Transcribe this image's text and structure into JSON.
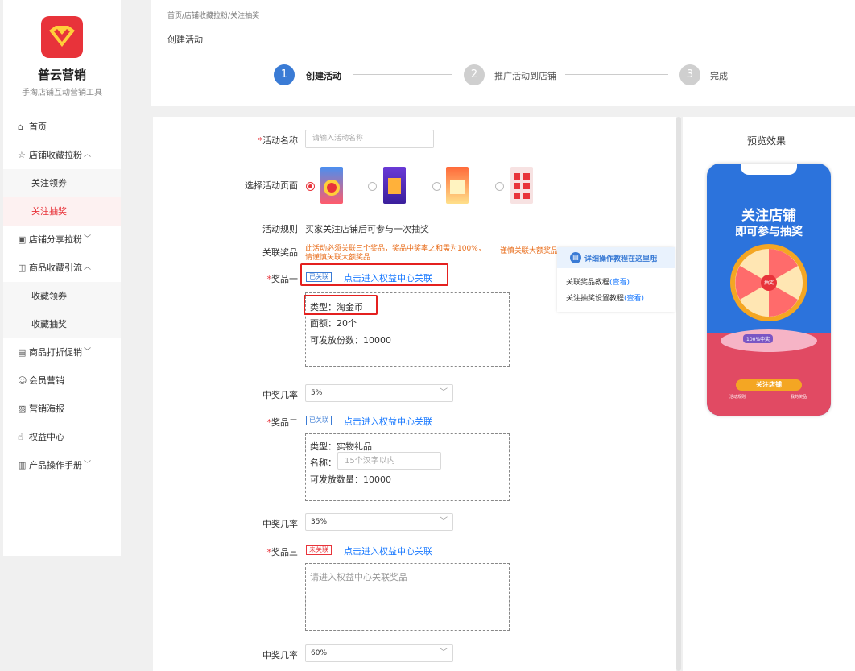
{
  "sidebar": {
    "brand": "普云营销",
    "brand_sub": "手淘店铺互动营销工具",
    "home": "首页",
    "group1": "店铺收藏拉粉",
    "group1_items": [
      "关注领券",
      "关注抽奖"
    ],
    "group2": "店铺分享拉粉",
    "group3": "商品收藏引流",
    "group3_items": [
      "收藏领券",
      "收藏抽奖"
    ],
    "group4": "商品打折促销",
    "members": "会员营销",
    "poster": "营销海报",
    "rights": "权益中心",
    "manual": "产品操作手册"
  },
  "header": {
    "breadcrumb": "首页/店铺收藏拉粉/关注抽奖",
    "title": "创建活动",
    "steps": [
      {
        "num": "1",
        "label": "创建活动"
      },
      {
        "num": "2",
        "label": "推广活动到店铺"
      },
      {
        "num": "3",
        "label": "完成"
      }
    ]
  },
  "form": {
    "name_label": "活动名称",
    "name_placeholder": "请输入活动名称",
    "page_label": "选择活动页面",
    "rule_label": "活动规则",
    "rule_value": "买家关注店铺后可参与一次抽奖",
    "prize_label": "关联奖品",
    "prize_warn_1": "此活动必须关联三个奖品，奖品中奖率之和需为100%，",
    "prize_warn_2": "请谨慎关联大额奖品",
    "prize_warn_3": "谨慎关联大额奖品",
    "prize1": {
      "label": "奖品一",
      "tag": "已关联",
      "link": "点击进入权益中心关联",
      "type": "类型：淘金币",
      "amount": "面额：20个",
      "count": "可发放份数：10000",
      "rate_label": "中奖几率",
      "rate": "5%"
    },
    "prize2": {
      "label": "奖品二",
      "tag": "已关联",
      "link": "点击进入权益中心关联",
      "type": "类型：实物礼品",
      "name_label": "名称：",
      "name_placeholder": "15个汉字以内",
      "count": "可发放数量：10000",
      "rate_label": "中奖几率",
      "rate": "35%"
    },
    "prize3": {
      "label": "奖品三",
      "tag": "未关联",
      "link": "点击进入权益中心关联",
      "placeholder": "请进入权益中心关联奖品",
      "rate_label": "中奖几率",
      "rate": "60%"
    }
  },
  "tips": {
    "title": "详细操作教程在这里哦",
    "line1": "关联奖品教程",
    "line2": "关注抽奖设置教程",
    "view": "(查看)"
  },
  "preview": {
    "title": "预览效果",
    "phone_title_1": "关注店铺",
    "phone_title_2": "即可参与抽奖",
    "center_btn": "抽奖",
    "button": "关注店铺",
    "left_link": "活动规则",
    "right_link": "我的奖品",
    "badge": "100%中奖"
  },
  "colors": {
    "brand_red": "#e8333a",
    "step_active": "#3a7bd5",
    "step_inactive": "#cfcfcf",
    "link_blue": "#1677ff",
    "warn_orange": "#e86c1a",
    "highlight_red": "#e4201f"
  }
}
